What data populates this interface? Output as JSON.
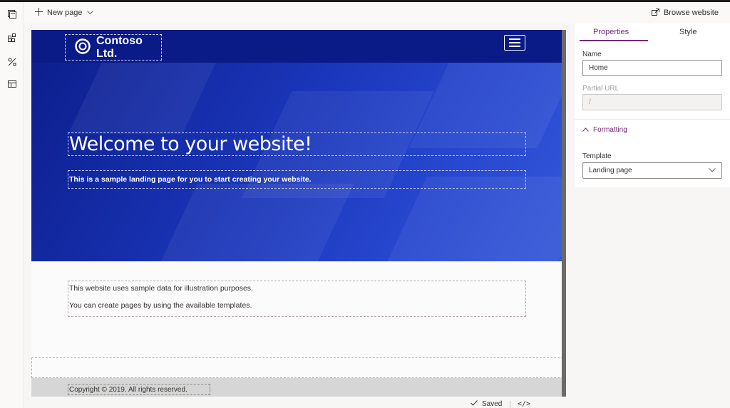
{
  "command_bar": {
    "new_page_label": "New page",
    "browse_label": "Browse website"
  },
  "rail": {
    "items": [
      "pages-icon",
      "components-icon",
      "themes-icon",
      "templates-icon"
    ]
  },
  "site": {
    "logo_text": "Contoso Ltd.",
    "hero_title": "Welcome to your website!",
    "hero_subtitle": "This is a sample landing page for you to start creating your website.",
    "content_lines": [
      "This website uses sample data for illustration purposes.",
      "You can create pages by using the available templates."
    ],
    "footer_text": "Copyright © 2019. All rights reserved."
  },
  "status": {
    "saved_label": "Saved",
    "code_label": "</>"
  },
  "panel": {
    "tabs": [
      "Properties",
      "Style"
    ],
    "active_tab": "Properties",
    "name_label": "Name",
    "name_value": "Home",
    "url_label": "Partial URL",
    "url_value": "/",
    "formatting_label": "Formatting",
    "template_label": "Template",
    "template_value": "Landing page"
  },
  "colors": {
    "accent": "#742774",
    "header_bg": "#0a1a86",
    "hero_bg": "#1a35b8"
  }
}
